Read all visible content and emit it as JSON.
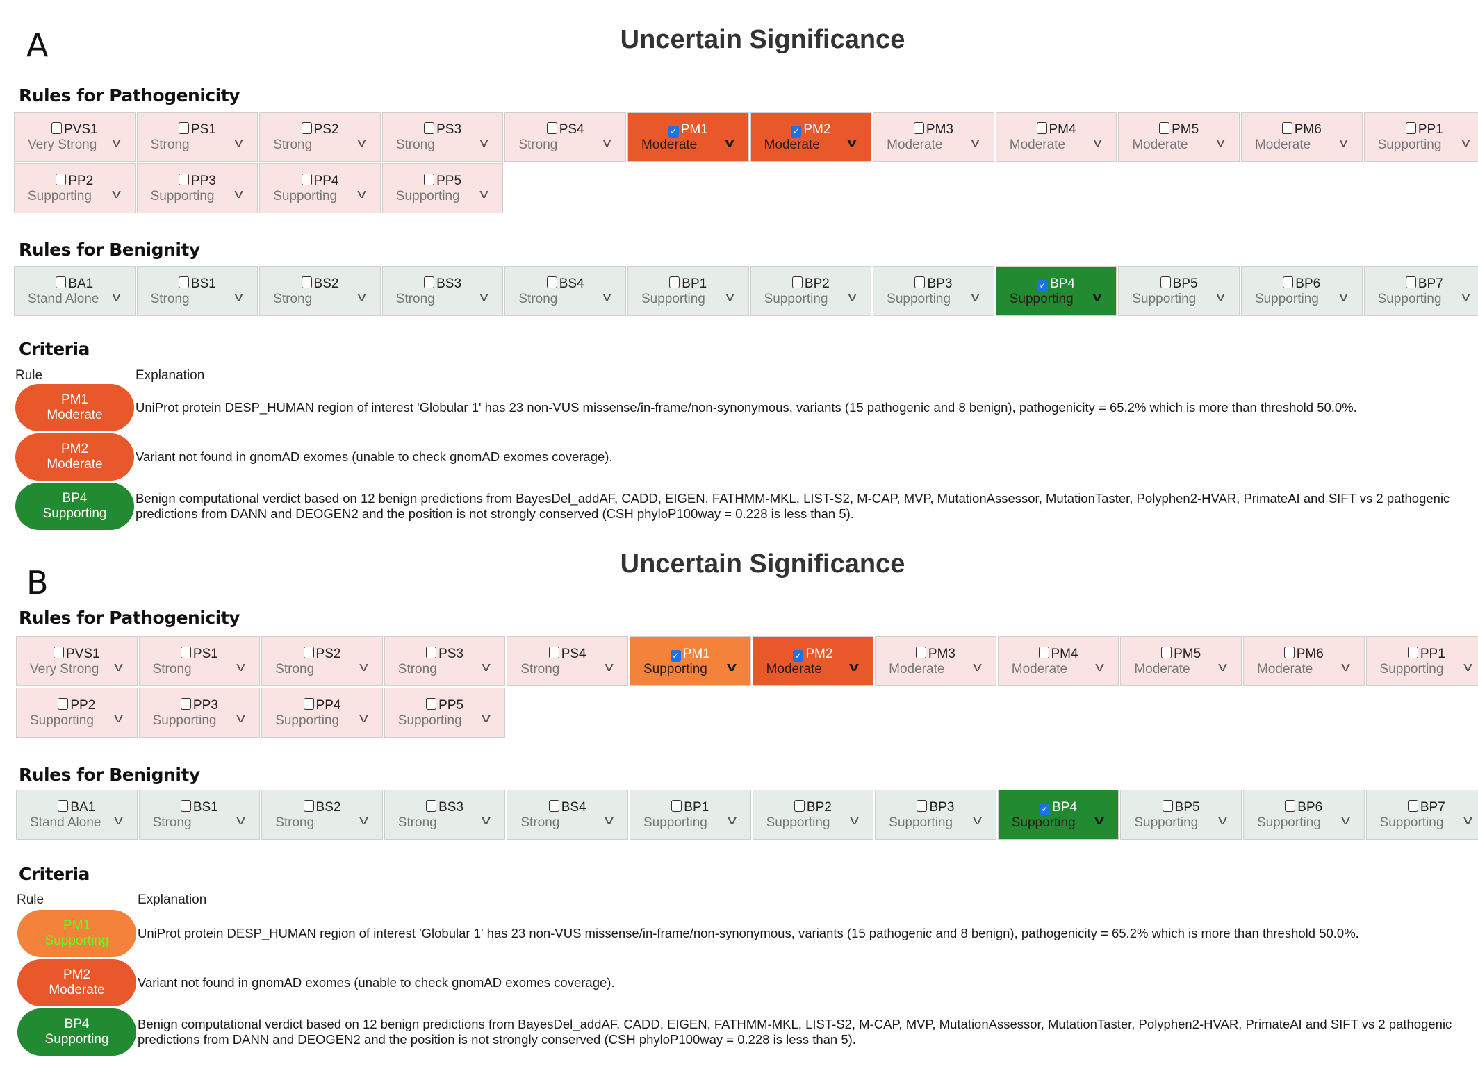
{
  "colors": {
    "pathogenic_bg": "#f9e3e3",
    "benign_bg": "#e6ede8",
    "moderate_checked": "#e8582a",
    "supporting_path_checked": "#f5823a",
    "benign_checked": "#228b31",
    "checkbox_blue": "#1a73e8",
    "pill_highlight_text": "#5cff1e"
  },
  "panels": [
    {
      "letter": "A",
      "verdict": "Uncertain Significance",
      "pathogenicity_heading": "Rules for Pathogenicity",
      "pathogenicity_rules": [
        {
          "rule": "PVS1",
          "strength": "Very Strong",
          "checked": false
        },
        {
          "rule": "PS1",
          "strength": "Strong",
          "checked": false
        },
        {
          "rule": "PS2",
          "strength": "Strong",
          "checked": false
        },
        {
          "rule": "PS3",
          "strength": "Strong",
          "checked": false
        },
        {
          "rule": "PS4",
          "strength": "Strong",
          "checked": false
        },
        {
          "rule": "PM1",
          "strength": "Moderate",
          "checked": true,
          "color": "#e8582a"
        },
        {
          "rule": "PM2",
          "strength": "Moderate",
          "checked": true,
          "color": "#e8582a"
        },
        {
          "rule": "PM3",
          "strength": "Moderate",
          "checked": false
        },
        {
          "rule": "PM4",
          "strength": "Moderate",
          "checked": false
        },
        {
          "rule": "PM5",
          "strength": "Moderate",
          "checked": false
        },
        {
          "rule": "PM6",
          "strength": "Moderate",
          "checked": false
        },
        {
          "rule": "PP1",
          "strength": "Supporting",
          "checked": false
        },
        {
          "rule": "PP2",
          "strength": "Supporting",
          "checked": false
        },
        {
          "rule": "PP3",
          "strength": "Supporting",
          "checked": false
        },
        {
          "rule": "PP4",
          "strength": "Supporting",
          "checked": false
        },
        {
          "rule": "PP5",
          "strength": "Supporting",
          "checked": false
        }
      ],
      "benignity_heading": "Rules for Benignity",
      "benignity_rules": [
        {
          "rule": "BA1",
          "strength": "Stand Alone",
          "checked": false
        },
        {
          "rule": "BS1",
          "strength": "Strong",
          "checked": false
        },
        {
          "rule": "BS2",
          "strength": "Strong",
          "checked": false
        },
        {
          "rule": "BS3",
          "strength": "Strong",
          "checked": false
        },
        {
          "rule": "BS4",
          "strength": "Strong",
          "checked": false
        },
        {
          "rule": "BP1",
          "strength": "Supporting",
          "checked": false
        },
        {
          "rule": "BP2",
          "strength": "Supporting",
          "checked": false
        },
        {
          "rule": "BP3",
          "strength": "Supporting",
          "checked": false
        },
        {
          "rule": "BP4",
          "strength": "Supporting",
          "checked": true,
          "color": "#228b31"
        },
        {
          "rule": "BP5",
          "strength": "Supporting",
          "checked": false
        },
        {
          "rule": "BP6",
          "strength": "Supporting",
          "checked": false
        },
        {
          "rule": "BP7",
          "strength": "Supporting",
          "checked": false
        }
      ],
      "criteria_heading": "Criteria",
      "criteria_col_rule": "Rule",
      "criteria_col_explanation": "Explanation",
      "criteria": [
        {
          "rule": "PM1",
          "strength": "Moderate",
          "color": "#e8582a",
          "text_color": "#ffffff",
          "lines": [
            "UniProt protein DESP_HUMAN region of interest 'Globular 1' has 23 non-VUS missense/in-frame/non-synonymous, variants (15 pathogenic and 8 benign), pathogenicity = 65.2% which is more than threshold 50.0%."
          ]
        },
        {
          "rule": "PM2",
          "strength": "Moderate",
          "color": "#e8582a",
          "text_color": "#ffffff",
          "lines": [
            "Variant not found in gnomAD exomes (unable to check gnomAD exomes coverage)."
          ]
        },
        {
          "rule": "BP4",
          "strength": "Supporting",
          "color": "#228b31",
          "text_color": "#ffffff",
          "lines": [
            "Benign computational verdict based on 12 benign predictions from BayesDel_addAF, CADD, EIGEN, FATHMM-MKL, LIST-S2, M-CAP, MVP, MutationAssessor, MutationTaster, Polyphen2-HVAR, PrimateAI and SIFT vs 2 pathogenic",
            "predictions from DANN and DEOGEN2 and the position is not strongly conserved (CSH phyloP100way = 0.228 is less than 5)."
          ]
        }
      ]
    },
    {
      "letter": "B",
      "verdict": "Uncertain Significance",
      "pathogenicity_heading": "Rules for Pathogenicity",
      "pathogenicity_rules": [
        {
          "rule": "PVS1",
          "strength": "Very Strong",
          "checked": false
        },
        {
          "rule": "PS1",
          "strength": "Strong",
          "checked": false
        },
        {
          "rule": "PS2",
          "strength": "Strong",
          "checked": false
        },
        {
          "rule": "PS3",
          "strength": "Strong",
          "checked": false
        },
        {
          "rule": "PS4",
          "strength": "Strong",
          "checked": false
        },
        {
          "rule": "PM1",
          "strength": "Supporting",
          "checked": true,
          "color": "#f5823a"
        },
        {
          "rule": "PM2",
          "strength": "Moderate",
          "checked": true,
          "color": "#e8582a"
        },
        {
          "rule": "PM3",
          "strength": "Moderate",
          "checked": false
        },
        {
          "rule": "PM4",
          "strength": "Moderate",
          "checked": false
        },
        {
          "rule": "PM5",
          "strength": "Moderate",
          "checked": false
        },
        {
          "rule": "PM6",
          "strength": "Moderate",
          "checked": false
        },
        {
          "rule": "PP1",
          "strength": "Supporting",
          "checked": false
        },
        {
          "rule": "PP2",
          "strength": "Supporting",
          "checked": false
        },
        {
          "rule": "PP3",
          "strength": "Supporting",
          "checked": false
        },
        {
          "rule": "PP4",
          "strength": "Supporting",
          "checked": false
        },
        {
          "rule": "PP5",
          "strength": "Supporting",
          "checked": false
        }
      ],
      "benignity_heading": "Rules for Benignity",
      "benignity_rules": [
        {
          "rule": "BA1",
          "strength": "Stand Alone",
          "checked": false
        },
        {
          "rule": "BS1",
          "strength": "Strong",
          "checked": false
        },
        {
          "rule": "BS2",
          "strength": "Strong",
          "checked": false
        },
        {
          "rule": "BS3",
          "strength": "Strong",
          "checked": false
        },
        {
          "rule": "BS4",
          "strength": "Strong",
          "checked": false
        },
        {
          "rule": "BP1",
          "strength": "Supporting",
          "checked": false
        },
        {
          "rule": "BP2",
          "strength": "Supporting",
          "checked": false
        },
        {
          "rule": "BP3",
          "strength": "Supporting",
          "checked": false
        },
        {
          "rule": "BP4",
          "strength": "Supporting",
          "checked": true,
          "color": "#228b31"
        },
        {
          "rule": "BP5",
          "strength": "Supporting",
          "checked": false
        },
        {
          "rule": "BP6",
          "strength": "Supporting",
          "checked": false
        },
        {
          "rule": "BP7",
          "strength": "Supporting",
          "checked": false
        }
      ],
      "criteria_heading": "Criteria",
      "criteria_col_rule": "Rule",
      "criteria_col_explanation": "Explanation",
      "criteria": [
        {
          "rule": "PM1",
          "strength": "Supporting",
          "color": "#f5823a",
          "text_color": "#5cff1e",
          "lines": [
            "UniProt protein DESP_HUMAN region of interest 'Globular 1' has 23 non-VUS missense/in-frame/non-synonymous, variants (15 pathogenic and 8 benign), pathogenicity = 65.2% which is more than threshold 50.0%."
          ]
        },
        {
          "rule": "PM2",
          "strength": "Moderate",
          "color": "#e8582a",
          "text_color": "#ffffff",
          "lines": [
            "Variant not found in gnomAD exomes (unable to check gnomAD exomes coverage)."
          ]
        },
        {
          "rule": "BP4",
          "strength": "Supporting",
          "color": "#228b31",
          "text_color": "#ffffff",
          "lines": [
            "Benign computational verdict based on 12 benign predictions from BayesDel_addAF, CADD, EIGEN, FATHMM-MKL, LIST-S2, M-CAP, MVP, MutationAssessor, MutationTaster, Polyphen2-HVAR, PrimateAI and SIFT vs 2 pathogenic",
            "predictions from DANN and DEOGEN2 and the position is not strongly conserved (CSH phyloP100way = 0.228 is less than 5)."
          ]
        }
      ]
    }
  ]
}
